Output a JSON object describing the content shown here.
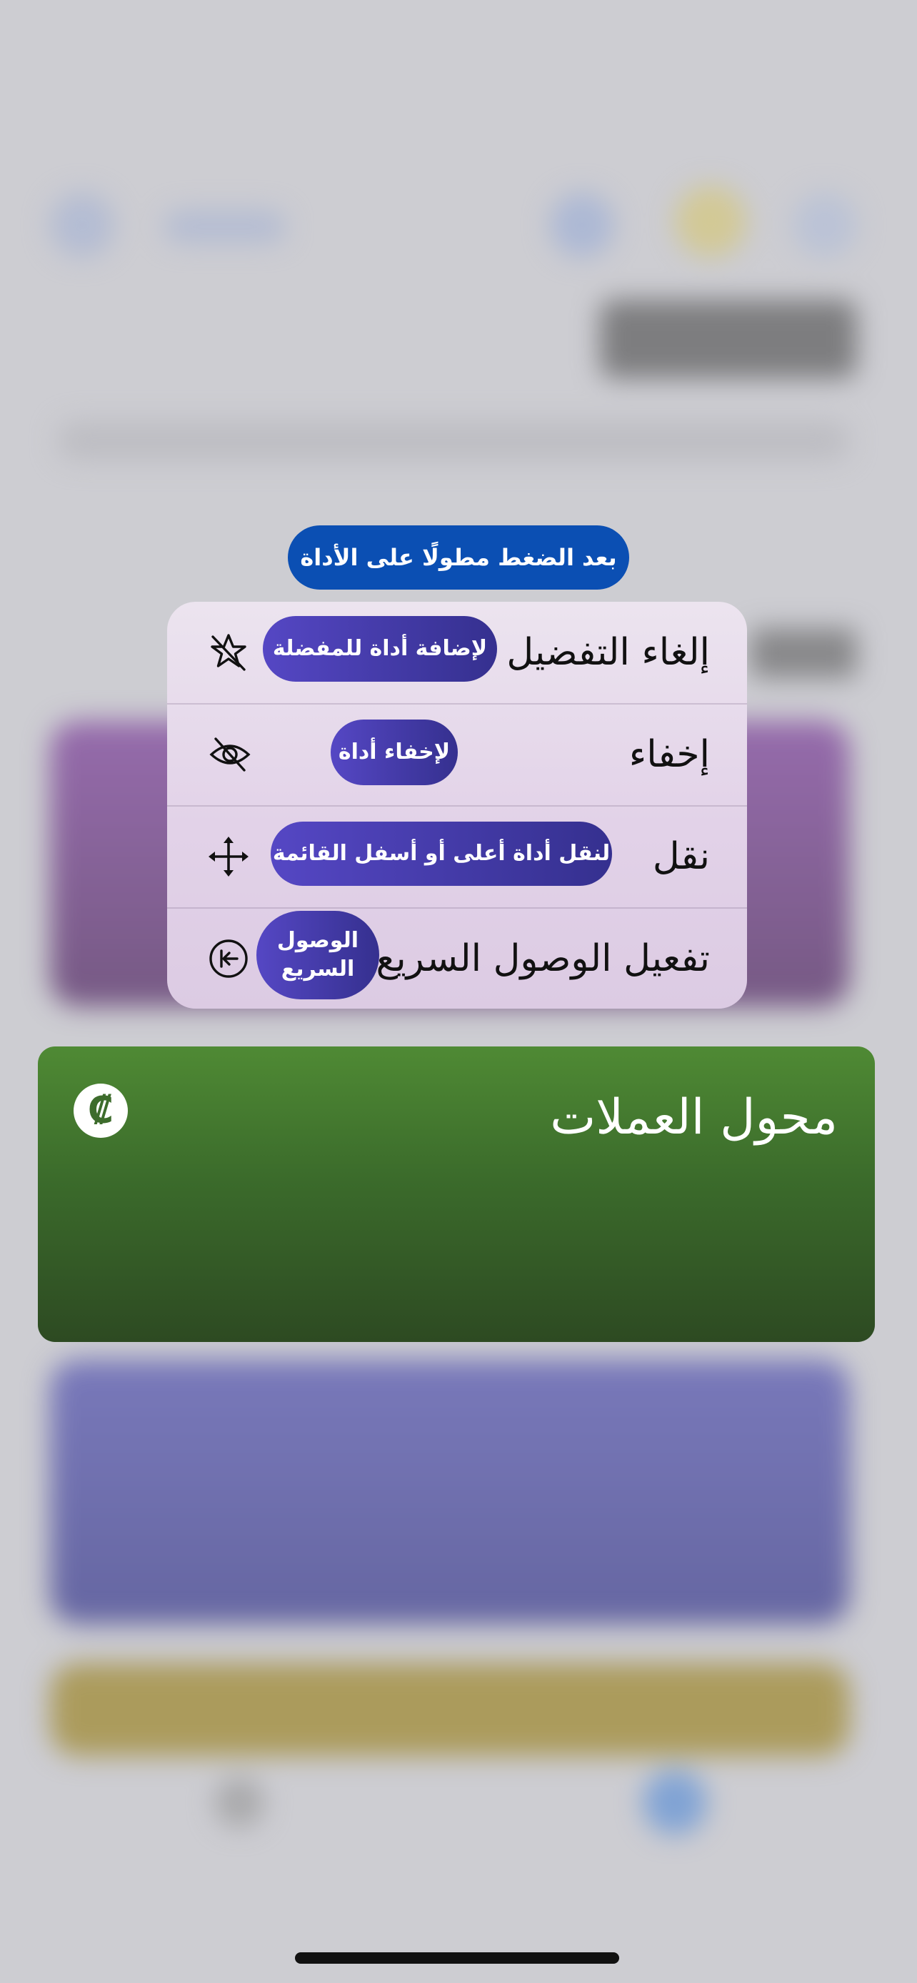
{
  "hint": "بعد الضغط مطولًا على الأداة",
  "menu": {
    "items": [
      {
        "label": "إلغاء التفضيل",
        "badge": "لإضافة أداة للمفضلة",
        "icon": "star-slash-icon"
      },
      {
        "label": "إخفاء",
        "badge": "لإخفاء أداة",
        "icon": "eye-slash-icon"
      },
      {
        "label": "نقل",
        "badge": "لنقل أداة أعلى أو أسفل القائمة",
        "icon": "move-arrows-icon"
      },
      {
        "label": "تفعيل الوصول السريع",
        "badge": "الوصول السريع",
        "icon": "quick-access-icon"
      }
    ]
  },
  "widget": {
    "title": "محول العملات",
    "icon": "colon-currency-icon",
    "icon_glyph": "₡",
    "color": "#3b6b2b"
  },
  "colors": {
    "hint_bg": "#0b4fb3",
    "badge_bg": "#4a3fb8",
    "menu_bg": "#e6d9eb"
  }
}
